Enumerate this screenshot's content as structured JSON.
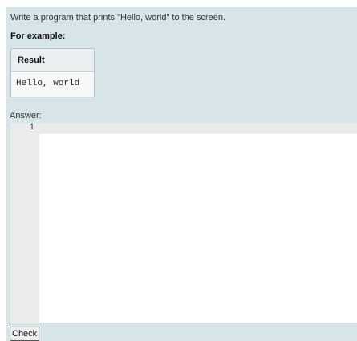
{
  "question": {
    "text": "Write a program that prints \"Hello, world\" to the screen."
  },
  "example": {
    "heading": "For example:",
    "table": {
      "header": "Result",
      "rows": [
        "Hello, world"
      ]
    }
  },
  "answer": {
    "label": "Answer:",
    "line_numbers": [
      "1"
    ],
    "code": ""
  },
  "actions": {
    "check_label": "Check"
  }
}
